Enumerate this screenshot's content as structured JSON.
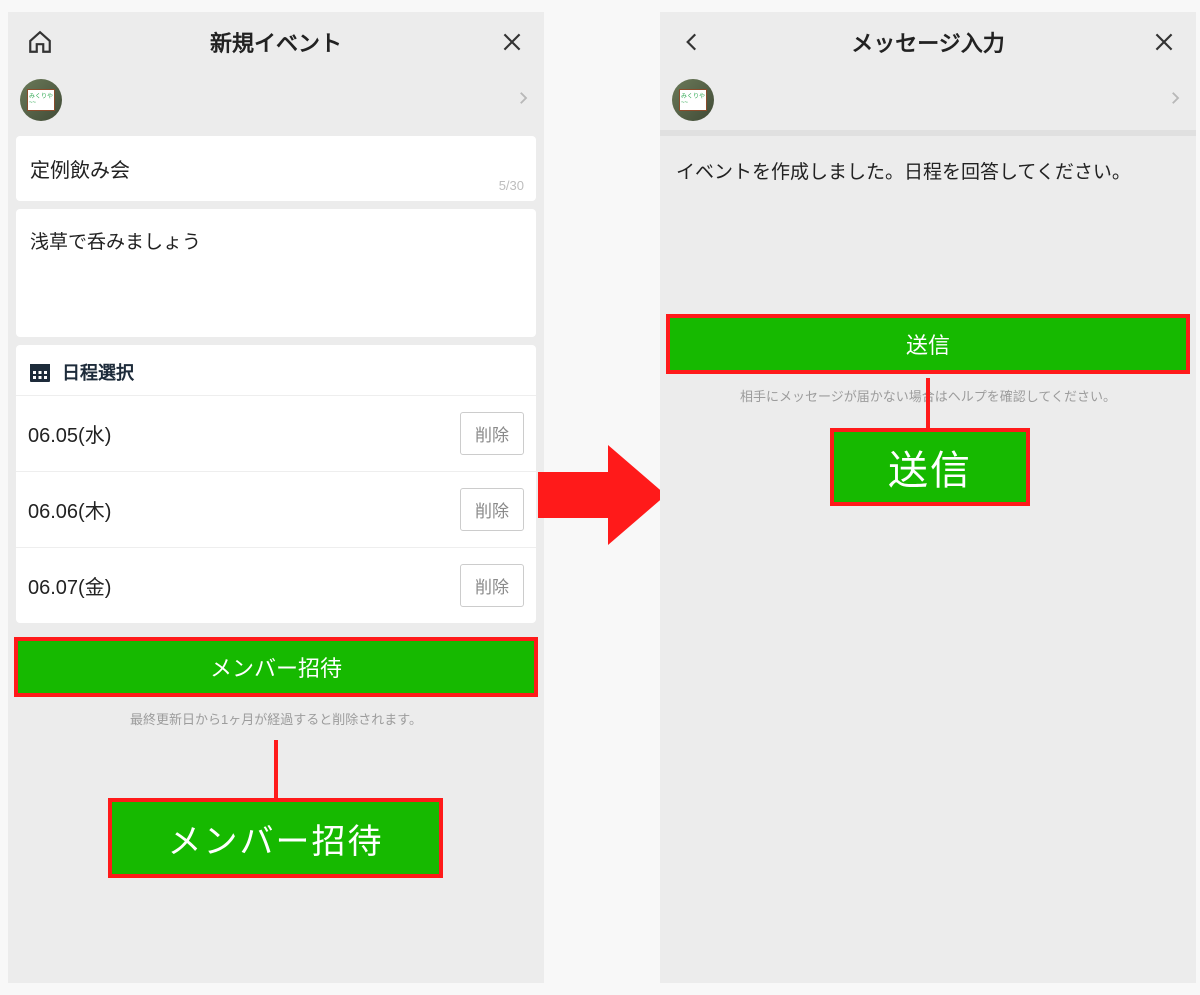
{
  "left": {
    "header_title": "新規イベント",
    "event_name": "定例飲み会",
    "event_name_counter": "5/30",
    "event_desc": "浅草で呑みましょう",
    "date_header": "日程選択",
    "dates": [
      "06.05(水)",
      "06.06(木)",
      "06.07(金)"
    ],
    "delete_label": "削除",
    "invite_label": "メンバー招待",
    "hint": "最終更新日から1ヶ月が経過すると削除されます。",
    "callout_label": "メンバー招待"
  },
  "right": {
    "header_title": "メッセージ入力",
    "message": "イベントを作成しました。日程を回答してください。",
    "send_label": "送信",
    "hint": "相手にメッセージが届かない場合はヘルプを確認してください。",
    "callout_label": "送信"
  }
}
